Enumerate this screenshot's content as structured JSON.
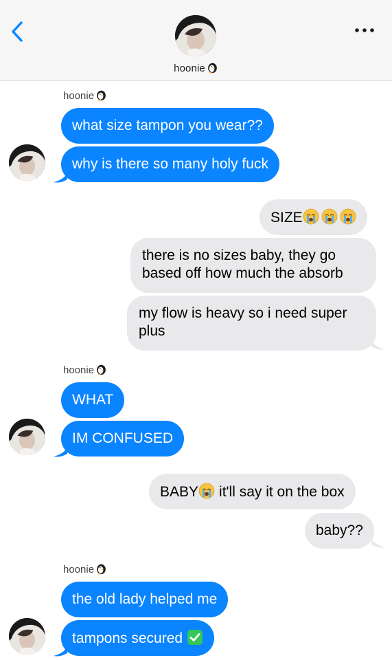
{
  "header": {
    "contact_name": "hoonie",
    "name_emoji_icon": "penguin-emoji-icon",
    "back_icon": "chevron-left-icon",
    "more_icon": "ellipsis-icon"
  },
  "colors": {
    "incoming_bubble": "#0a84ff",
    "outgoing_bubble": "#e9e9eb",
    "accent": "#0a84ff"
  },
  "groups": [
    {
      "side": "incoming",
      "sender": "hoonie",
      "messages": [
        "what size tampon you wear??",
        "why is there so many holy fuck"
      ]
    },
    {
      "side": "outgoing",
      "messages": [
        "SIZE",
        "there is no sizes baby, they go based off how much the absorb",
        "my flow is heavy so i need super plus"
      ]
    },
    {
      "side": "incoming",
      "sender": "hoonie",
      "messages": [
        "WHAT",
        "IM CONFUSED"
      ]
    },
    {
      "side": "outgoing",
      "messages": [
        "BABY",
        "it'll say it on the box",
        "baby??"
      ]
    },
    {
      "side": "incoming",
      "sender": "hoonie",
      "messages": [
        "the old lady helped me",
        "tampons secured"
      ]
    }
  ],
  "emojis": {
    "size_suffix": [
      "crying-face-emoji-icon",
      "crying-face-emoji-icon",
      "crying-face-emoji-icon"
    ],
    "baby_suffix": "crying-face-emoji-icon",
    "secured_suffix": "check-mark-button-emoji-icon"
  }
}
